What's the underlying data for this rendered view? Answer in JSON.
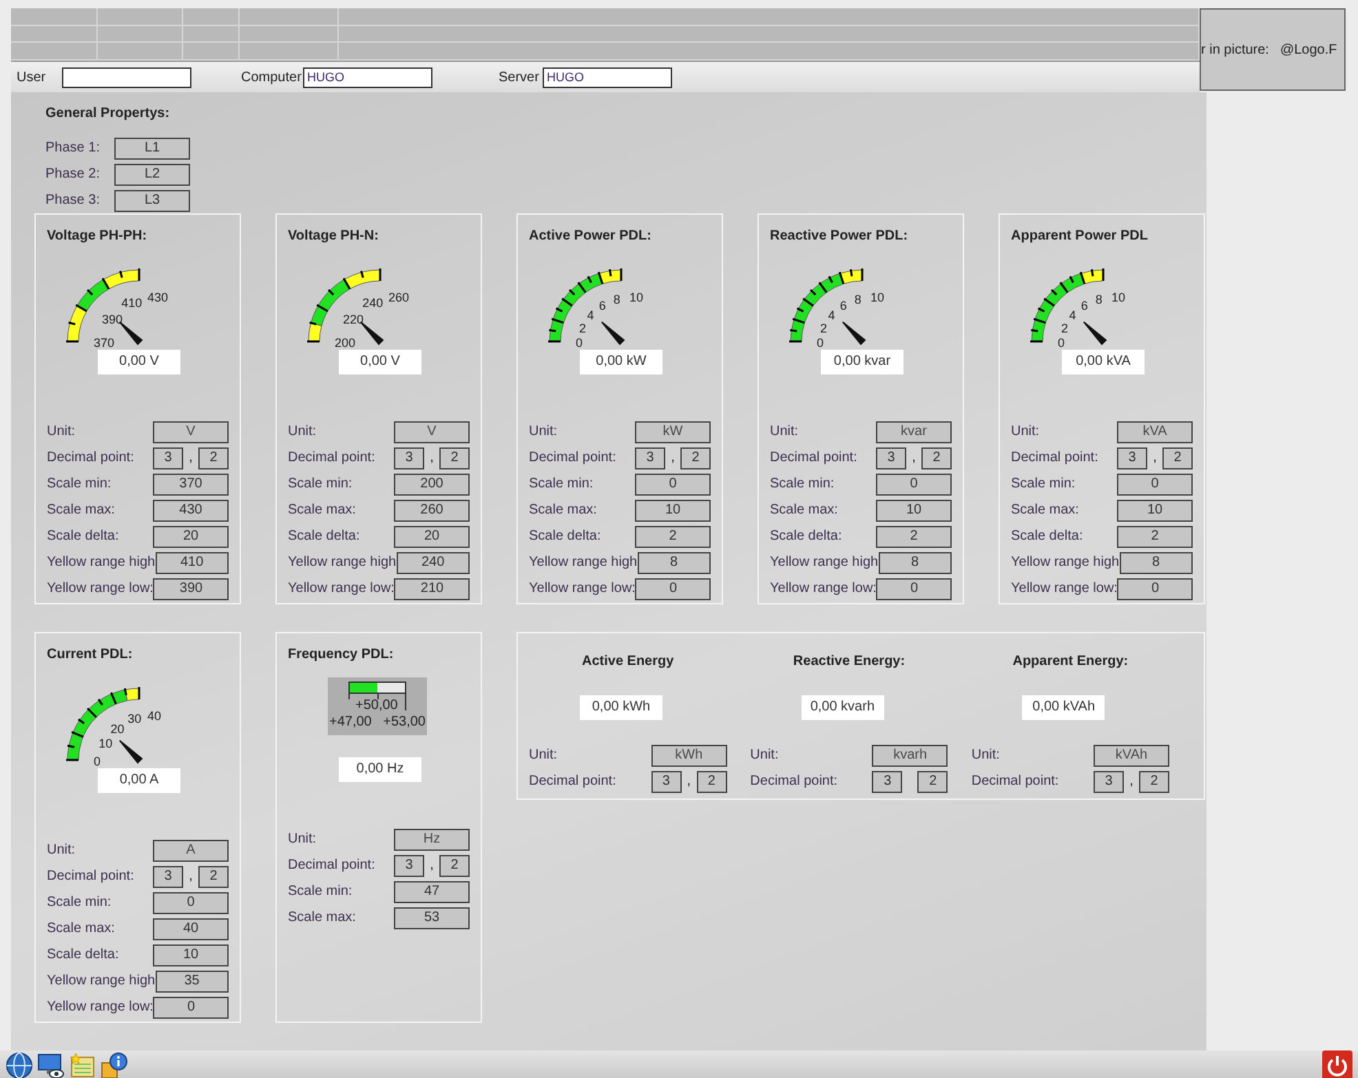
{
  "logo_box": {
    "label": "r in picture:",
    "value": "@Logo.F"
  },
  "login_fields": [
    {
      "label": "User"
    },
    {
      "label": "Computer",
      "value": "HUGO"
    },
    {
      "label": "Server",
      "value": "HUGO"
    }
  ],
  "general": {
    "title": "General Propertys:",
    "phases": [
      {
        "label": "Phase 1:",
        "value": "L1"
      },
      {
        "label": "Phase 2:",
        "value": "L2"
      },
      {
        "label": "Phase 3:",
        "value": "L3"
      }
    ]
  },
  "panel_rows": [
    [
      {
        "title": "Voltage PH-PH:",
        "kind": "arc",
        "scale_labels": [
          "370",
          "390",
          "410",
          "430"
        ],
        "reading": "0,00 V",
        "params": [
          {
            "kind": "unit",
            "label": "Unit:",
            "value": "V"
          },
          {
            "kind": "decimal",
            "label": "Decimal point:",
            "digits": "3",
            "separator": ",",
            "decimals": "2"
          },
          {
            "kind": "scale_min",
            "label": "Scale min:",
            "value": "370"
          },
          {
            "kind": "scale_max",
            "label": "Scale max:",
            "value": "430"
          },
          {
            "kind": "scale_delta",
            "label": "Scale delta:",
            "value": "20"
          },
          {
            "kind": "yellow_high",
            "label": "Yellow range high",
            "value": "410"
          },
          {
            "kind": "yellow_low",
            "label": "Yellow range low:",
            "value": "390"
          }
        ]
      },
      {
        "title": "Voltage PH-N:",
        "kind": "arc",
        "scale_labels": [
          "200",
          "220",
          "240",
          "260"
        ],
        "reading": "0,00 V",
        "params": [
          {
            "kind": "unit",
            "label": "Unit:",
            "value": "V"
          },
          {
            "kind": "decimal",
            "label": "Decimal point:",
            "digits": "3",
            "separator": ",",
            "decimals": "2"
          },
          {
            "kind": "scale_min",
            "label": "Scale min:",
            "value": "200"
          },
          {
            "kind": "scale_max",
            "label": "Scale max:",
            "value": "260"
          },
          {
            "kind": "scale_delta",
            "label": "Scale delta:",
            "value": "20"
          },
          {
            "kind": "yellow_high",
            "label": "Yellow range high",
            "value": "240"
          },
          {
            "kind": "yellow_low",
            "label": "Yellow range low:",
            "value": "210"
          }
        ]
      },
      {
        "title": "Active Power PDL:",
        "kind": "arc",
        "scale_labels": [
          "0",
          "2",
          "4",
          "6",
          "8",
          "10"
        ],
        "reading": "0,00 kW",
        "params": [
          {
            "kind": "unit",
            "label": "Unit:",
            "value": "kW"
          },
          {
            "kind": "decimal",
            "label": "Decimal point:",
            "digits": "3",
            "separator": ",",
            "decimals": "2"
          },
          {
            "kind": "scale_min",
            "label": "Scale min:",
            "value": "0"
          },
          {
            "kind": "scale_max",
            "label": "Scale max:",
            "value": "10"
          },
          {
            "kind": "scale_delta",
            "label": "Scale delta:",
            "value": "2"
          },
          {
            "kind": "yellow_high",
            "label": "Yellow range high",
            "value": "8"
          },
          {
            "kind": "yellow_low",
            "label": "Yellow range low:",
            "value": "0"
          }
        ]
      },
      {
        "title": "Reactive Power PDL:",
        "kind": "arc",
        "scale_labels": [
          "0",
          "2",
          "4",
          "6",
          "8",
          "10"
        ],
        "reading": "0,00 kvar",
        "params": [
          {
            "kind": "unit",
            "label": "Unit:",
            "value": "kvar"
          },
          {
            "kind": "decimal",
            "label": "Decimal point:",
            "digits": "3",
            "separator": ",",
            "decimals": "2"
          },
          {
            "kind": "scale_min",
            "label": "Scale min:",
            "value": "0"
          },
          {
            "kind": "scale_max",
            "label": "Scale max:",
            "value": "10"
          },
          {
            "kind": "scale_delta",
            "label": "Scale delta:",
            "value": "2"
          },
          {
            "kind": "yellow_high",
            "label": "Yellow range high",
            "value": "8"
          },
          {
            "kind": "yellow_low",
            "label": "Yellow range low:",
            "value": "0"
          }
        ]
      },
      {
        "title": "Apparent Power PDL",
        "kind": "arc",
        "scale_labels": [
          "0",
          "2",
          "4",
          "6",
          "8",
          "10"
        ],
        "reading": "0,00 kVA",
        "params": [
          {
            "kind": "unit",
            "label": "Unit:",
            "value": "kVA"
          },
          {
            "kind": "decimal",
            "label": "Decimal point:",
            "digits": "3",
            "separator": ",",
            "decimals": "2"
          },
          {
            "kind": "scale_min",
            "label": "Scale min:",
            "value": "0"
          },
          {
            "kind": "scale_max",
            "label": "Scale max:",
            "value": "10"
          },
          {
            "kind": "scale_delta",
            "label": "Scale delta:",
            "value": "2"
          },
          {
            "kind": "yellow_high",
            "label": "Yellow range high",
            "value": "8"
          },
          {
            "kind": "yellow_low",
            "label": "Yellow range low:",
            "value": "0"
          }
        ]
      }
    ],
    [
      {
        "title": "Current PDL:",
        "kind": "arc",
        "scale_labels": [
          "0",
          "10",
          "20",
          "30",
          "40"
        ],
        "reading": "0,00 A",
        "params": [
          {
            "kind": "unit",
            "label": "Unit:",
            "value": "A"
          },
          {
            "kind": "decimal",
            "label": "Decimal point:",
            "digits": "3",
            "separator": ",",
            "decimals": "2"
          },
          {
            "kind": "scale_min",
            "label": "Scale min:",
            "value": "0"
          },
          {
            "kind": "scale_max",
            "label": "Scale max:",
            "value": "40"
          },
          {
            "kind": "scale_delta",
            "label": "Scale delta:",
            "value": "10"
          },
          {
            "kind": "yellow_high",
            "label": "Yellow range high",
            "value": "35"
          },
          {
            "kind": "yellow_low",
            "label": "Yellow range low:",
            "value": "0"
          }
        ]
      },
      {
        "title": "Frequency PDL:",
        "kind": "bar",
        "bar": {
          "level": 0.5,
          "center_label": "+50,00",
          "min_label": "+47,00",
          "max_label": "+53,00"
        },
        "reading": "0,00 Hz",
        "params": [
          {
            "kind": "unit",
            "label": "Unit:",
            "value": "Hz"
          },
          {
            "kind": "decimal",
            "label": "Decimal point:",
            "digits": "3",
            "separator": ",",
            "decimals": "2"
          },
          {
            "kind": "scale_min",
            "label": "Scale min:",
            "value": "47"
          },
          {
            "kind": "scale_max",
            "label": "Scale max:",
            "value": "53"
          }
        ]
      }
    ]
  ],
  "energy_panel": {
    "columns": [
      {
        "title": "Active Energy",
        "reading": "0,00 kWh",
        "params": [
          {
            "kind": "unit",
            "label": "Unit:",
            "value": "kWh"
          },
          {
            "kind": "decimal",
            "label": "Decimal point:",
            "digits": "3",
            "separator": ",",
            "decimals": "2"
          }
        ]
      },
      {
        "title": "Reactive Energy:",
        "reading": "0,00 kvarh",
        "params": [
          {
            "kind": "unit",
            "label": "Unit:",
            "value": "kvarh"
          },
          {
            "kind": "decimal",
            "label": "Decimal point:",
            "digits": "3",
            "decimals": "2"
          }
        ]
      },
      {
        "title": "Apparent Energy:",
        "reading": "0,00 kVAh",
        "params": [
          {
            "kind": "unit",
            "label": "Unit:",
            "value": "kVAh"
          },
          {
            "kind": "decimal",
            "label": "Decimal point:",
            "digits": "3",
            "separator": ",",
            "decimals": "2"
          }
        ]
      }
    ]
  }
}
